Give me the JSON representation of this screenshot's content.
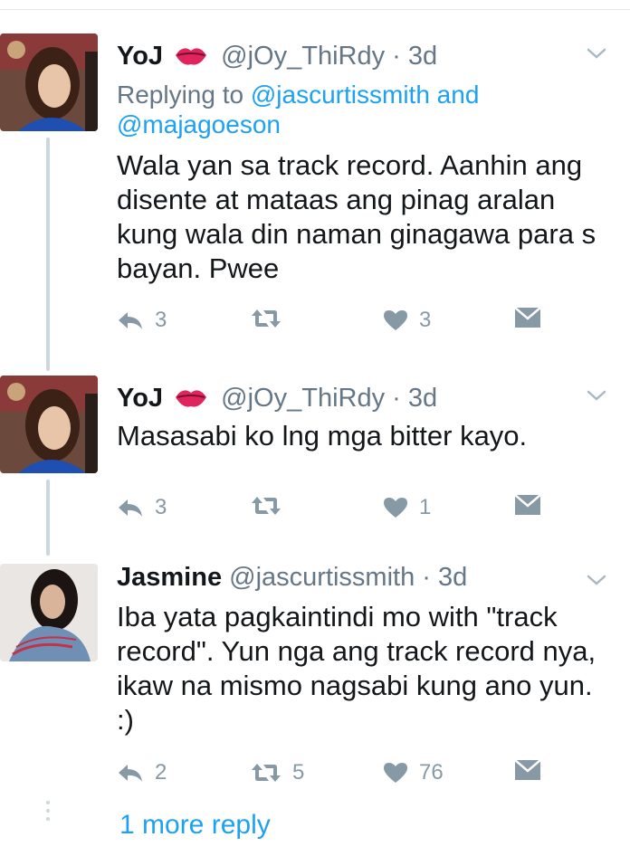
{
  "tweets": [
    {
      "name": "YoJ",
      "handle": "@jOy_ThiRdy",
      "sep": "·",
      "time": "3d",
      "replying_prefix": "Replying to",
      "replying_to_1": "@jascurtissmith",
      "replying_and": "and",
      "replying_to_2": "@majagoeson",
      "text": "Wala yan sa track record. Aanhin ang disente at mataas ang pinag aralan kung wala din naman ginagawa para s bayan. Pwee",
      "replies": "3",
      "retweets": "",
      "likes": "3"
    },
    {
      "name": "YoJ",
      "handle": "@jOy_ThiRdy",
      "sep": "·",
      "time": "3d",
      "text": "Masasabi ko lng mga bitter kayo.",
      "replies": "3",
      "retweets": "",
      "likes": "1"
    },
    {
      "name": "Jasmine",
      "handle": "@jascurtissmith",
      "sep": "·",
      "time": "3d",
      "text": "Iba yata pagkaintindi mo with \"track record\". Yun nga ang track record nya, ikaw na mismo nagsabi kung ano yun. :)",
      "replies": "2",
      "retweets": "5",
      "likes": "76"
    }
  ],
  "more_replies": "1 more reply",
  "colors": {
    "accent": "#1da1f2",
    "muted": "#657786",
    "icon": "#8899a6"
  }
}
